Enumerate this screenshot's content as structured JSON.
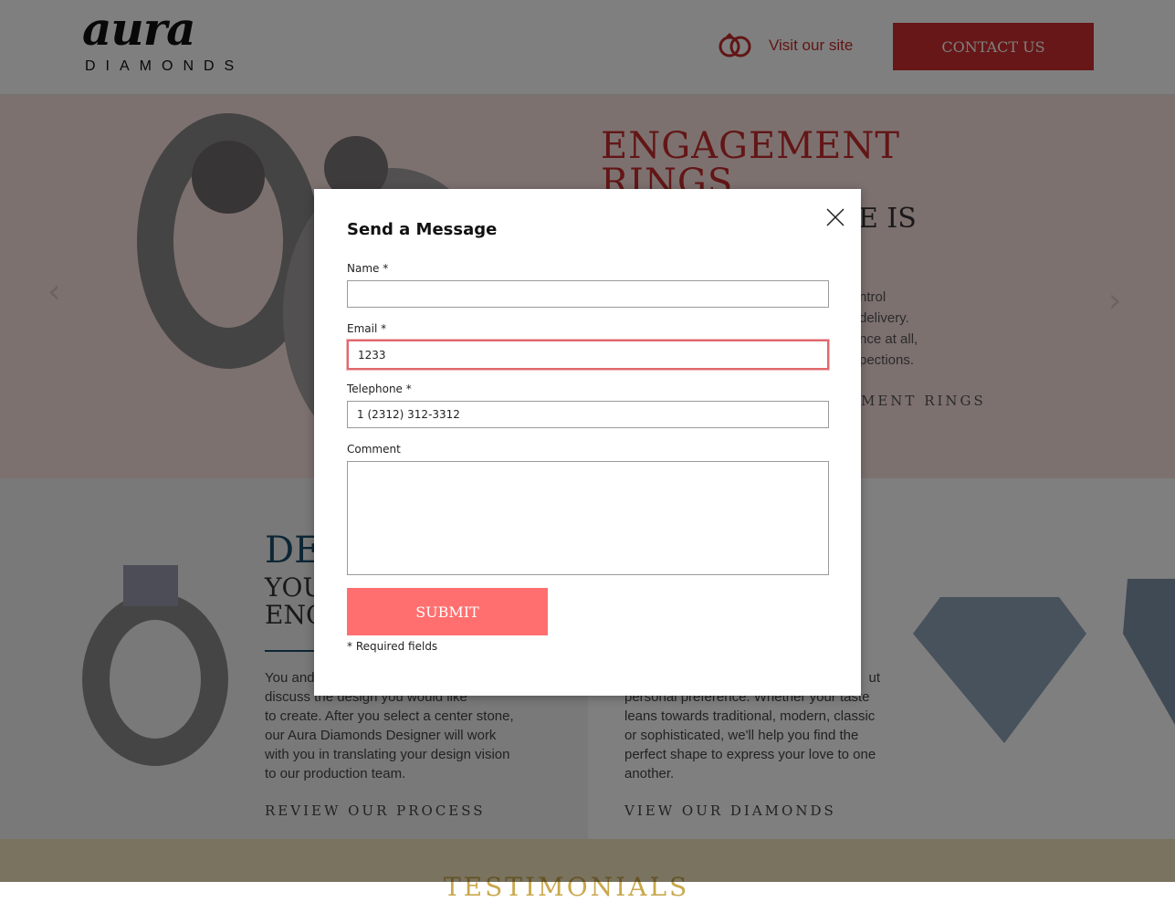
{
  "header": {
    "logo_word": "aura",
    "logo_sub": "DIAMONDS",
    "visit_label": "Visit our site",
    "contact_label": "CONTACT US"
  },
  "hero": {
    "title": "ENGAGEMENT RINGS",
    "subtitle_visible": "E IS",
    "body_visible": [
      "ntrol",
      "delivery.",
      "nce at all,",
      "pections."
    ],
    "link_visible": "MENT RINGS",
    "prev_arrow": "‹",
    "next_arrow": "›"
  },
  "design": {
    "title_visible": "DE",
    "subtitle_line1": "YOU",
    "subtitle_line2": "ENG",
    "body": [
      "You and",
      "discuss the design you would like",
      "to create. After you select a center stone,",
      "our Aura Diamonds Designer will work",
      "with you in translating your design vision",
      "to our production team."
    ],
    "link": "REVIEW OUR PROCESS"
  },
  "diamonds": {
    "body": [
      "ut",
      "personal preference. Whether your taste",
      "leans towards traditional, modern, classic",
      "or sophisticated, we'll help you find the",
      "perfect shape to express your love to one",
      "another."
    ],
    "link": "VIEW OUR DIAMONDS"
  },
  "footer": {
    "heading_visible": "TESTIMONIALS"
  },
  "modal": {
    "title": "Send a Message",
    "name_label": "Name *",
    "name_value": "",
    "email_label": "Email *",
    "email_value": "1233",
    "phone_label": "Telephone *",
    "phone_value": "1 (2312) 312-3312",
    "comment_label": "Comment",
    "comment_value": "",
    "submit_label": "SUBMIT",
    "required_note": "* Required fields"
  },
  "colors": {
    "brand_red": "#cf2e2e",
    "submit_coral": "#ff6f6f",
    "invalid_border": "#e0686c"
  }
}
